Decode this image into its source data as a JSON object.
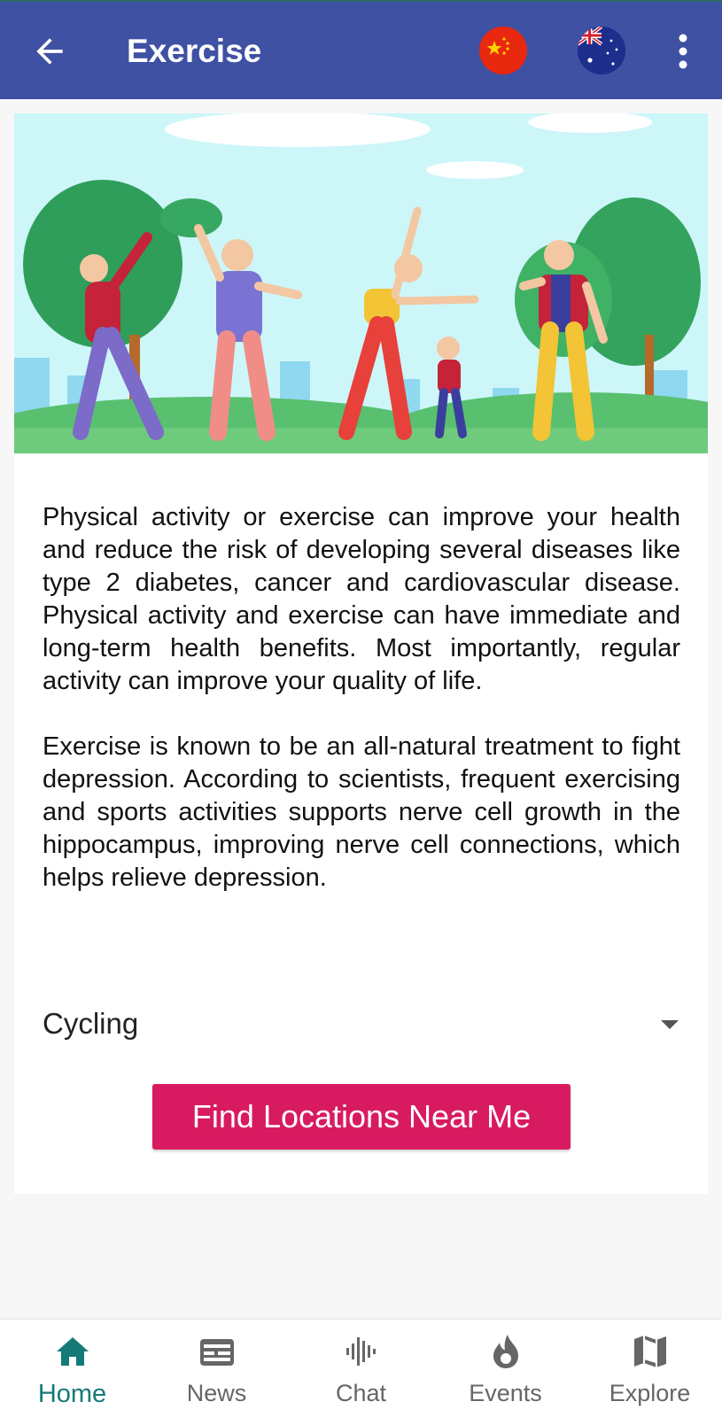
{
  "app_bar": {
    "title": "Exercise",
    "back_icon": "arrow-left-icon",
    "language_options": [
      "china-flag",
      "australia-flag"
    ],
    "more_icon": "more-vert-icon",
    "color": "#3f51a3"
  },
  "content": {
    "paragraphs": [
      "Physical activity or exercise can improve your health and reduce the risk of developing several diseases like type 2 diabetes, cancer and cardiovascular disease. Physical activity and exercise can have immediate and long-term health benefits. Most importantly, regular activity can improve your quality of life.",
      "Exercise is known to be an all-natural treatment to fight depression. According to scientists, frequent exercising and sports activities supports nerve cell growth in the hippocampus, improving nerve cell connections, which helps relieve depression."
    ],
    "activity_select": {
      "value": "Cycling"
    },
    "find_button": {
      "label": "Find Locations Near Me",
      "color": "#d81b60"
    }
  },
  "bottom_nav": {
    "active_color": "#147a78",
    "items": [
      {
        "label": "Home",
        "icon": "home-icon",
        "active": true
      },
      {
        "label": "News",
        "icon": "news-icon",
        "active": false
      },
      {
        "label": "Chat",
        "icon": "chat-icon",
        "active": false
      },
      {
        "label": "Events",
        "icon": "flame-icon",
        "active": false
      },
      {
        "label": "Explore",
        "icon": "map-icon",
        "active": false
      }
    ]
  }
}
